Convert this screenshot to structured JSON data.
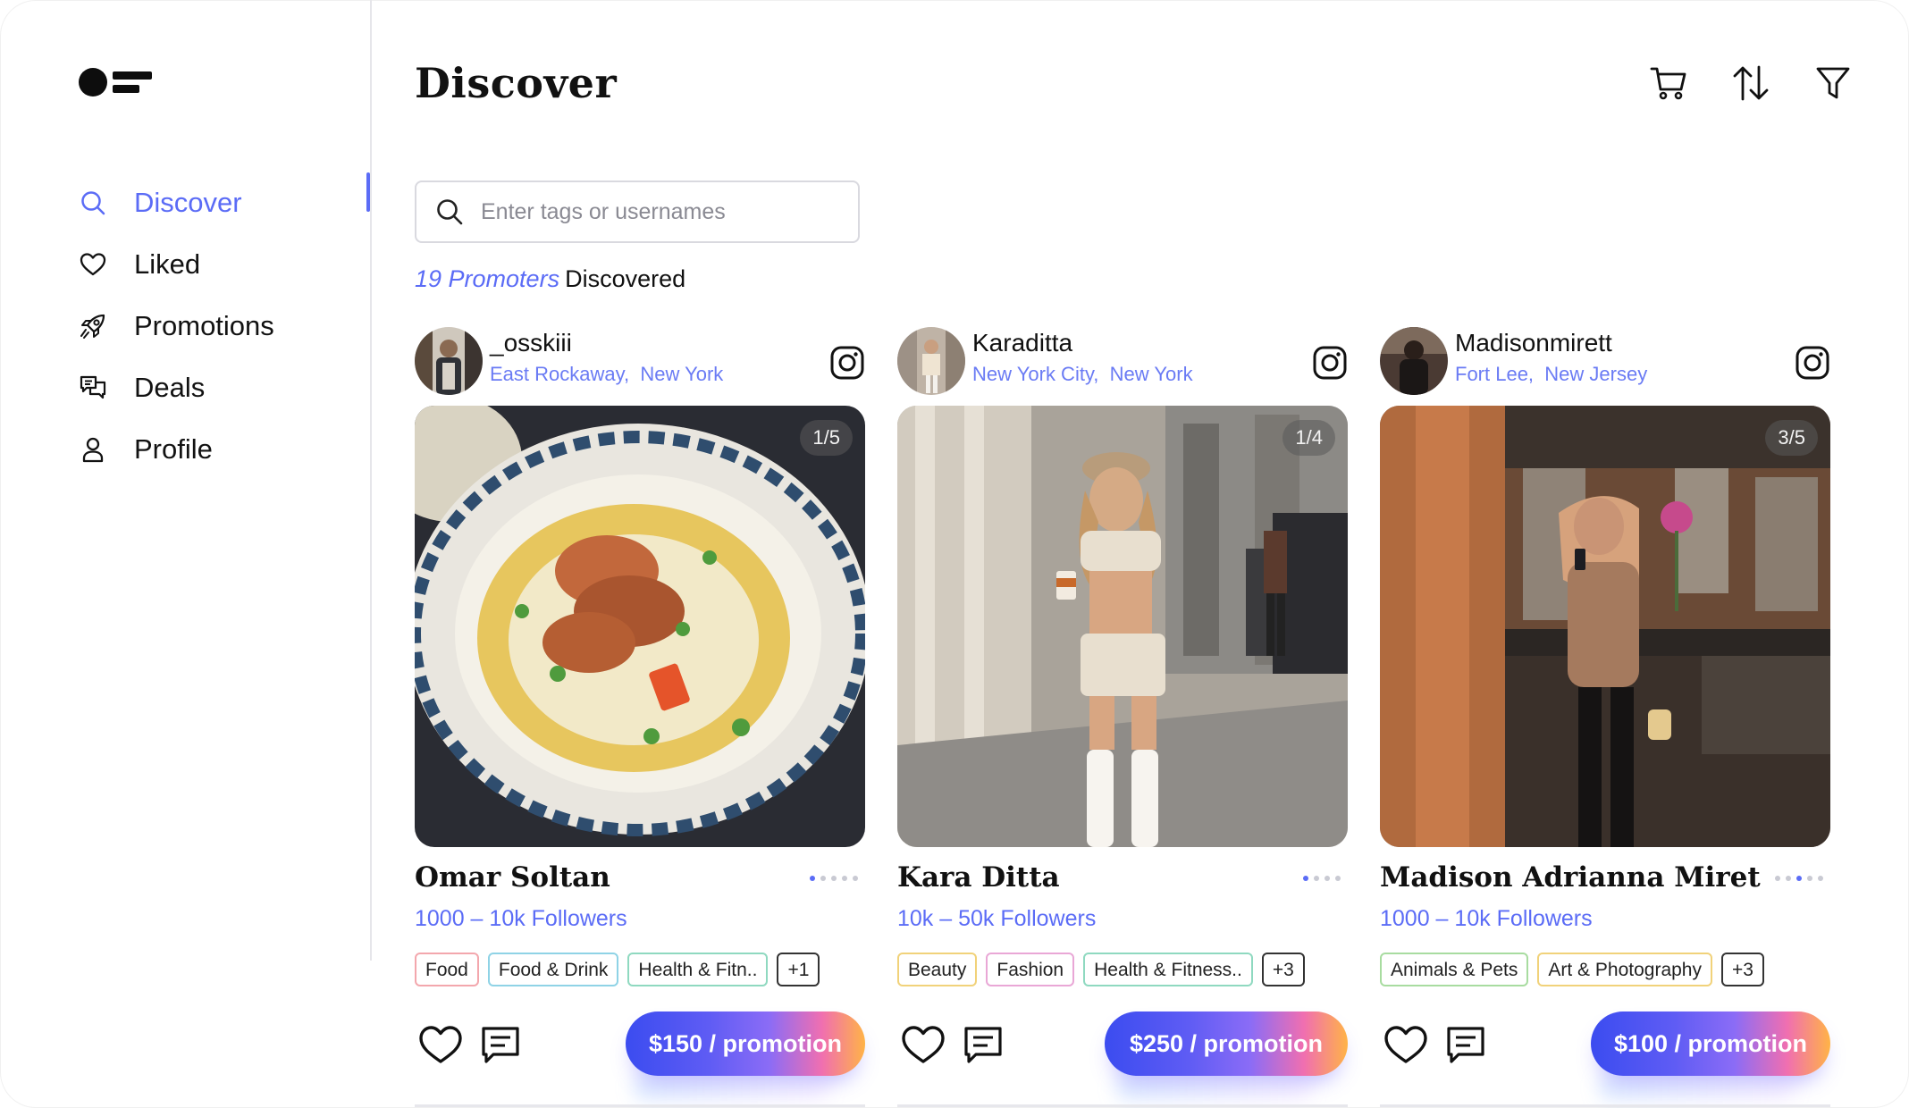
{
  "sidebar": {
    "items": [
      {
        "label": "Discover",
        "icon": "search-icon"
      },
      {
        "label": "Liked",
        "icon": "heart-icon"
      },
      {
        "label": "Promotions",
        "icon": "rocket-icon"
      },
      {
        "label": "Deals",
        "icon": "chat-bubbles-icon"
      },
      {
        "label": "Profile",
        "icon": "user-icon"
      }
    ]
  },
  "header": {
    "title": "Discover"
  },
  "search": {
    "placeholder": "Enter tags or usernames"
  },
  "results": {
    "count": "19 Promoters",
    "suffix": "Discovered"
  },
  "cards": [
    {
      "username": "_osskiii",
      "city": "East Rockaway,",
      "state": "New York",
      "counter": "1/5",
      "name": "Omar Soltan",
      "followers": "1000 – 10k Followers",
      "tags": [
        "Food",
        "Food & Drink",
        "Health & Fitn..",
        "+1"
      ],
      "price": "$150 / promotion",
      "dot_active": 0
    },
    {
      "username": "Karaditta",
      "city": "New York City,",
      "state": "New York",
      "counter": "1/4",
      "name": "Kara Ditta",
      "followers": "10k – 50k Followers",
      "tags": [
        "Beauty",
        "Fashion",
        "Health & Fitness..",
        "+3"
      ],
      "price": "$250 / promotion",
      "dot_active": 0
    },
    {
      "username": "Madisonmirett",
      "city": "Fort Lee,",
      "state": "New Jersey",
      "counter": "3/5",
      "name": "Madison Adrianna Miret",
      "followers": "1000 – 10k Followers",
      "tags": [
        "Animals & Pets",
        "Art & Photography",
        "+3"
      ],
      "price": "$100 / promotion",
      "dot_active": 2
    }
  ],
  "colors": {
    "accent": "#5b6cf6",
    "location": "#6a7bf4"
  }
}
